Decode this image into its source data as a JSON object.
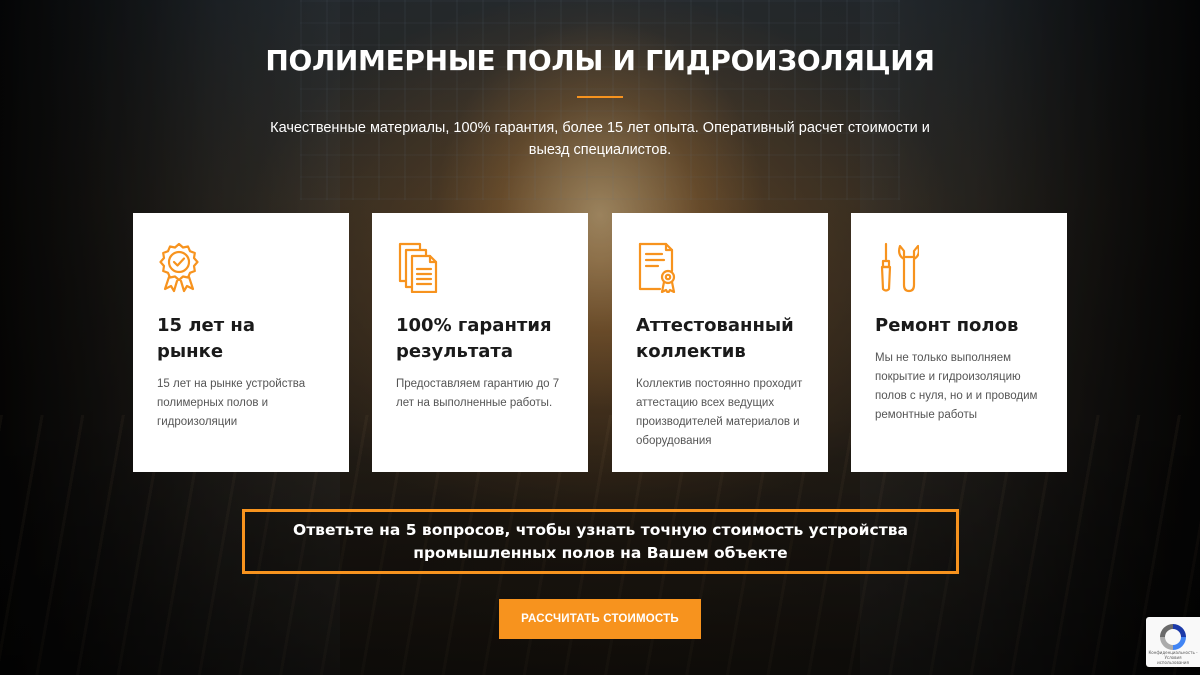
{
  "hero": {
    "title": "ПОЛИМЕРНЫЕ ПОЛЫ И ГИДРОИЗОЛЯЦИЯ",
    "subtitle": "Качественные материалы, 100% гарантия, более 15 лет опыта. Оперативный расчет стоимости и выезд специалистов."
  },
  "colors": {
    "accent": "#f7931e",
    "card_background": "#ffffff",
    "heading_text": "#1a1a1a",
    "body_text": "#555555"
  },
  "features": [
    {
      "icon": "award-badge-icon",
      "title": "15 лет на рынке",
      "text": "15 лет на рынке устройства полимерных полов и гидроизоляции"
    },
    {
      "icon": "documents-icon",
      "title": "100% гарантия результата",
      "text": "Предоставляем гарантию до 7 лет на выполненные работы."
    },
    {
      "icon": "certificate-icon",
      "title": "Аттестованный коллектив",
      "text": "Коллектив постоянно проходит аттестацию всех ведущих производителей материалов и оборудования"
    },
    {
      "icon": "tools-icon",
      "title": "Ремонт полов",
      "text": "Мы не только выполняем покрытие и гидроизоляцию полов с нуля, но и и проводим ремонтные работы"
    }
  ],
  "quiz": {
    "text": "Ответьте на 5 вопросов, чтобы узнать точную стоимость устройства промышленных полов на Вашем объекте"
  },
  "cta": {
    "label": "РАССЧИТАТЬ СТОИМОСТЬ"
  },
  "recaptcha": {
    "icon": "recaptcha-icon",
    "text": "Конфиденциальность - Условия использования"
  }
}
